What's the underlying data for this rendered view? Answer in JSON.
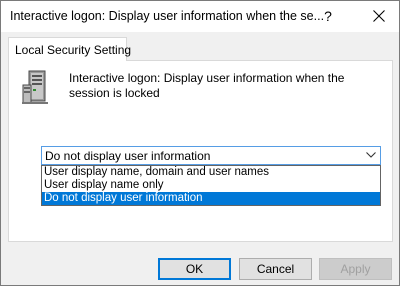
{
  "window": {
    "title": "Interactive logon: Display user information when the se...",
    "help_label": "?"
  },
  "tabs": [
    {
      "label": "Local Security Setting"
    }
  ],
  "policy": {
    "description": "Interactive logon: Display user information when the session is locked",
    "icon": "server-computer-icon"
  },
  "dropdown": {
    "selected": "Do not display user information",
    "options": [
      "User display name, domain and user names",
      "User display name only",
      "Do not display user information"
    ],
    "highlighted_index": 2
  },
  "buttons": {
    "ok": "OK",
    "cancel": "Cancel",
    "apply": "Apply"
  },
  "colors": {
    "selection": "#0078d7",
    "focus_border": "#569de5"
  }
}
